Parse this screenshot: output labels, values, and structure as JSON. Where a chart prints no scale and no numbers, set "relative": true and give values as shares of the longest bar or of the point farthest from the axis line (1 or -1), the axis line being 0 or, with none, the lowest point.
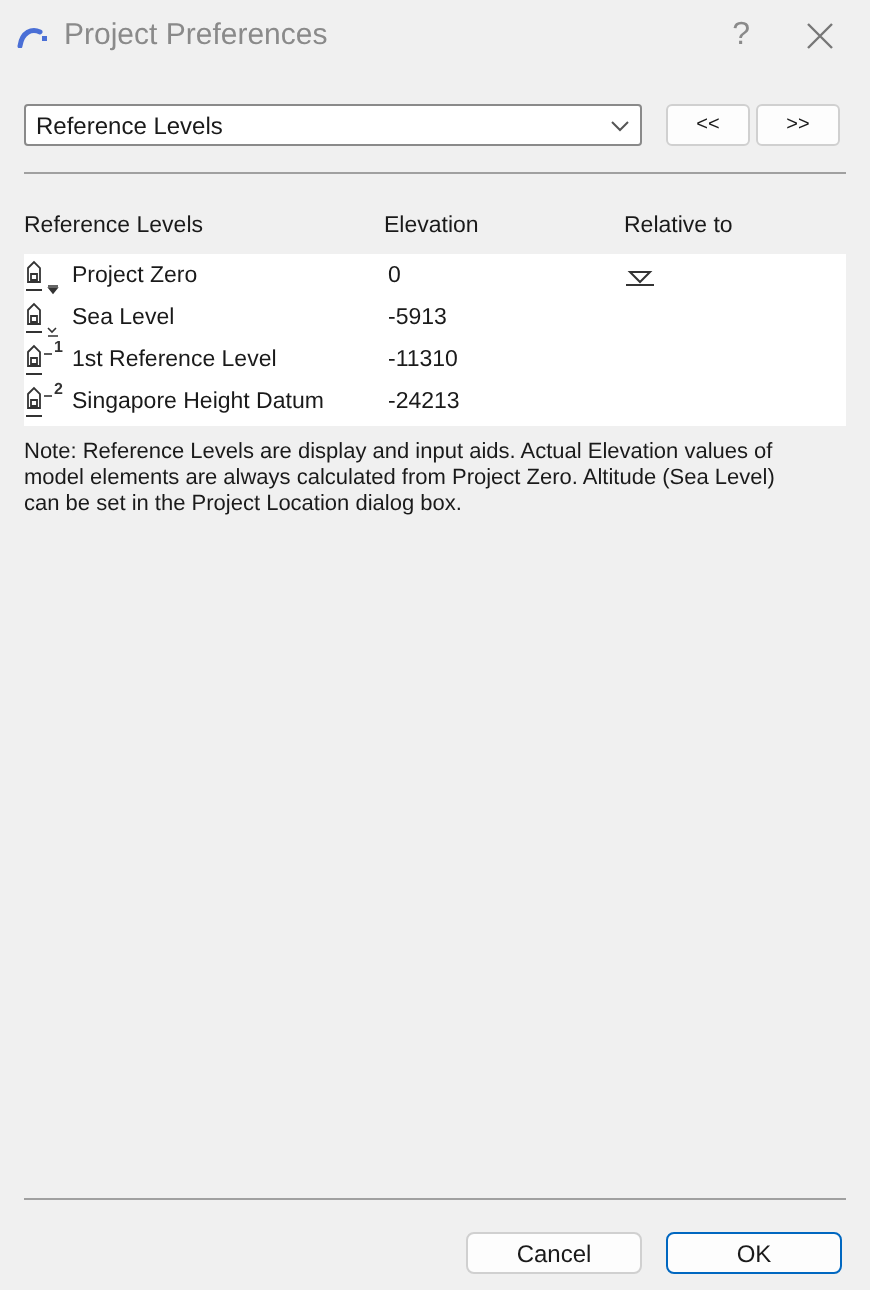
{
  "window": {
    "title": "Project Preferences",
    "help": "?"
  },
  "page_select": {
    "value": "Reference Levels"
  },
  "nav_buttons": [
    {
      "label": "<<"
    },
    {
      "label": ">>"
    }
  ],
  "table": {
    "columns": [
      "Reference Levels",
      "Elevation",
      "Relative to"
    ],
    "rows": [
      {
        "kind": "project-zero",
        "name": "Project Zero",
        "elevation": "0",
        "relative": true
      },
      {
        "kind": "sea-level",
        "name": "Sea Level",
        "elevation": "-5913",
        "relative": false
      },
      {
        "kind": "numbered",
        "index": "1",
        "name": "1st Reference Level",
        "elevation": "-11310",
        "relative": false
      },
      {
        "kind": "numbered",
        "index": "2",
        "name": "Singapore Height Datum",
        "elevation": "-24213",
        "relative": false
      }
    ]
  },
  "note": "Note: Reference Levels are display and input aids. Actual Elevation values of model elements are always calculated from Project Zero. Altitude (Sea Level) can be set in the Project Location dialog box.",
  "buttons": [
    {
      "label": "Cancel",
      "default": false
    },
    {
      "label": "OK",
      "default": true
    }
  ]
}
